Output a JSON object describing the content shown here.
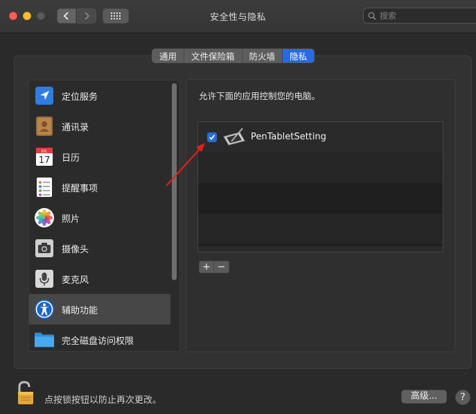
{
  "window": {
    "title": "安全性与隐私"
  },
  "search": {
    "placeholder": "搜索"
  },
  "tabs": [
    {
      "label": "通用",
      "active": false
    },
    {
      "label": "文件保险箱",
      "active": false
    },
    {
      "label": "防火墙",
      "active": false
    },
    {
      "label": "隐私",
      "active": true
    }
  ],
  "sidebar": {
    "items": [
      {
        "label": "定位服务",
        "icon": "location-arrow-icon"
      },
      {
        "label": "通讯录",
        "icon": "contacts-book-icon"
      },
      {
        "label": "日历",
        "icon": "calendar-icon",
        "calendar_month": "JUL",
        "calendar_day": "17"
      },
      {
        "label": "提醒事项",
        "icon": "reminders-icon"
      },
      {
        "label": "照片",
        "icon": "photos-icon"
      },
      {
        "label": "摄像头",
        "icon": "camera-icon"
      },
      {
        "label": "麦克风",
        "icon": "microphone-icon"
      },
      {
        "label": "辅助功能",
        "icon": "accessibility-icon",
        "selected": true
      },
      {
        "label": "完全磁盘访问权限",
        "icon": "folder-icon"
      }
    ]
  },
  "content": {
    "description": "允许下面的应用控制您的电脑。",
    "apps": [
      {
        "name": "PenTabletSetting",
        "checked": true,
        "icon": "pen-tablet-icon"
      }
    ],
    "add_label": "+",
    "remove_label": "−"
  },
  "footer": {
    "lock_text": "点按锁按钮以防止再次更改。",
    "advanced_label": "高级...",
    "help_label": "?"
  },
  "colors": {
    "accent": "#2a6ae1",
    "annotation_arrow": "#e02020"
  }
}
